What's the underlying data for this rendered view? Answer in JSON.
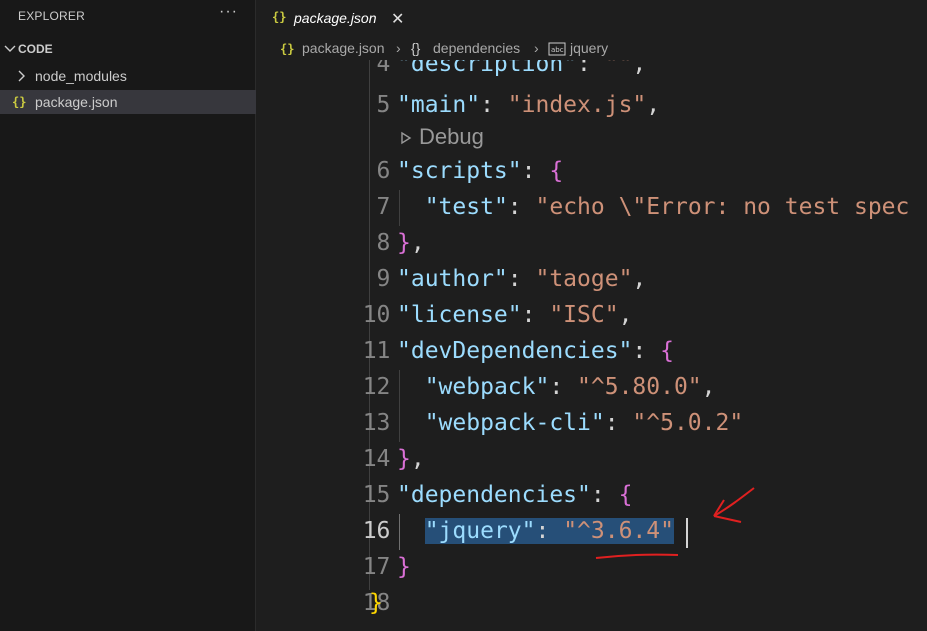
{
  "sidebar": {
    "header": "EXPLORER",
    "more": "···",
    "section": "CODE",
    "items": [
      {
        "label": "node_modules"
      },
      {
        "label": "package.json"
      }
    ]
  },
  "tab": {
    "icon": "{}",
    "label": "package.json",
    "close": "✕"
  },
  "breadcrumb": {
    "file": "package.json",
    "sep": "›",
    "obj_icon": "{}",
    "obj": "dependencies",
    "leaf": "jquery"
  },
  "editor": {
    "codelens": "Debug",
    "lines": [
      {
        "num": "4",
        "key": "\"description\"",
        "val": "\"\""
      },
      {
        "num": "5",
        "key": "\"main\"",
        "val": "\"index.js\""
      },
      {
        "num": "6",
        "key": "\"scripts\""
      },
      {
        "num": "7",
        "key": "\"test\"",
        "val": "\"echo \\\"Error: no test spec"
      },
      {
        "num": "8"
      },
      {
        "num": "9",
        "key": "\"author\"",
        "val": "\"taoge\""
      },
      {
        "num": "10",
        "key": "\"license\"",
        "val": "\"ISC\""
      },
      {
        "num": "11",
        "key": "\"devDependencies\""
      },
      {
        "num": "12",
        "key": "\"webpack\"",
        "val": "\"^5.80.0\""
      },
      {
        "num": "13",
        "key": "\"webpack-cli\"",
        "val": "\"^5.0.2\""
      },
      {
        "num": "14"
      },
      {
        "num": "15",
        "key": "\"dependencies\""
      },
      {
        "num": "16",
        "key": "\"jquery\"",
        "val": "\"^3.6.4\""
      },
      {
        "num": "17"
      },
      {
        "num": "18"
      }
    ]
  },
  "colors": {
    "background": "#1e1e1e",
    "sidebar": "#181818",
    "key": "#9cdcfe",
    "string": "#ce9178",
    "selection": "#264f78",
    "annotation": "#e02020"
  }
}
